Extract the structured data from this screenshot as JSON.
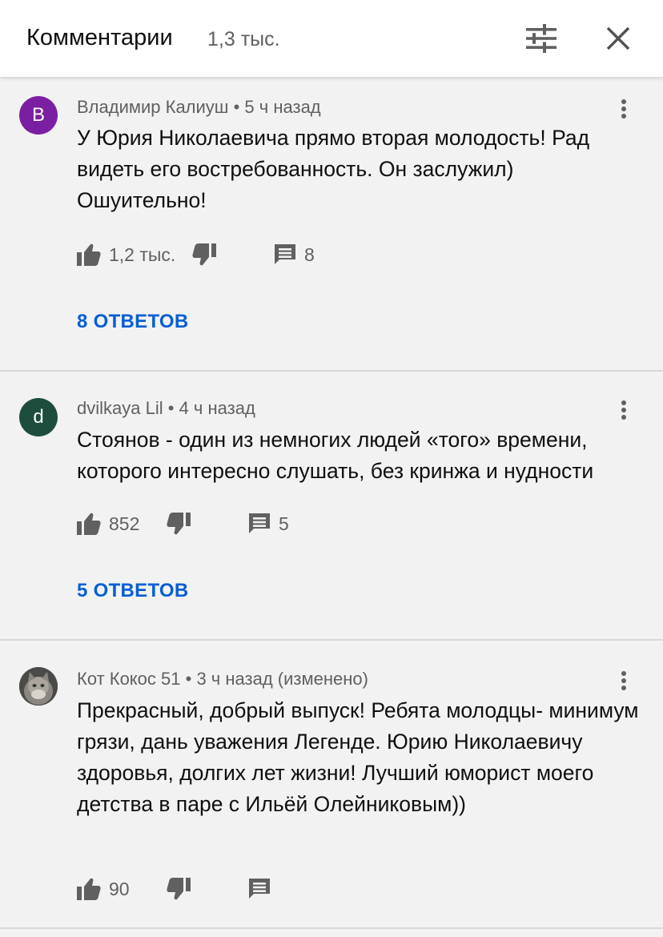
{
  "header": {
    "title": "Комментарии",
    "count": "1,3 тыс."
  },
  "colors": {
    "accent": "#065fd4",
    "avatar_v": "#7b1fa2",
    "avatar_d": "#1e4d3e"
  },
  "comments": [
    {
      "avatar_letter": "В",
      "author": "Владимир Калиуш",
      "time": "5 ч назад",
      "text": "У Юрия Николаевича прямо вторая молодость! Рад видеть его востребованность. Он заслужил) Ошуительно!",
      "likes": "1,2 тыс.",
      "reply_count": "8",
      "replies_label": "8 ОТВЕТОВ"
    },
    {
      "avatar_letter": "d",
      "author": "dvilkaya Lil",
      "time": "4 ч назад",
      "text": "Стоянов - один из немногих людей «того» времени, которого интересно слушать, без кринжа и нудности",
      "likes": "852",
      "reply_count": "5",
      "replies_label": "5 ОТВЕТОВ"
    },
    {
      "avatar_image": "cat-photo",
      "author": "Кот Кокос 51",
      "time": "3 ч назад (изменено)",
      "text": "Прекрасный, добрый выпуск! Ребята молодцы- минимум грязи, дань уважения Легенде. Юрию Николаевичу здоровья, долгих лет жизни!  Лучший юморист моего детства в паре с Ильёй Олейниковым))",
      "likes": "90"
    }
  ]
}
